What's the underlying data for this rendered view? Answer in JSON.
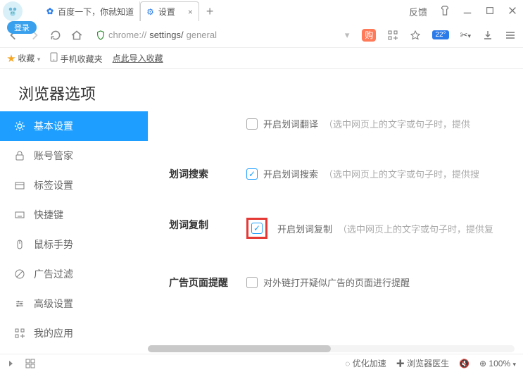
{
  "titlebar": {
    "login_label": "登录",
    "feedback": "反馈",
    "tabs": [
      {
        "title": "百度一下，你就知道",
        "icon": "paw"
      },
      {
        "title": "设置",
        "icon": "gear",
        "active": true
      }
    ]
  },
  "address": {
    "scheme": "chrome://",
    "path": "settings/",
    "page": "general",
    "temp": "22°"
  },
  "bookmarks": {
    "fav_label": "收藏",
    "mobile_fav": "手机收藏夹",
    "import_hint": "点此导入收藏"
  },
  "page": {
    "title": "浏览器选项"
  },
  "sidebar": {
    "items": [
      {
        "label": "基本设置",
        "active": true
      },
      {
        "label": "账号管家"
      },
      {
        "label": "标签设置"
      },
      {
        "label": "快捷键"
      },
      {
        "label": "鼠标手势"
      },
      {
        "label": "广告过滤"
      },
      {
        "label": "高级设置"
      },
      {
        "label": "我的应用"
      }
    ]
  },
  "settings": {
    "translate": {
      "opt_label": "开启划词翻译",
      "hint": "（选中网页上的文字或句子时，提供",
      "checked": false
    },
    "search": {
      "section": "划词搜索",
      "opt_label": "开启划词搜索",
      "hint": "（选中网页上的文字或句子时，提供搜",
      "checked": true
    },
    "copy": {
      "section": "划词复制",
      "opt_label": "开启划词复制",
      "hint": "（选中网页上的文字或句子时，提供复",
      "checked": true,
      "highlighted": true
    },
    "ad": {
      "section": "广告页面提醒",
      "opt_label": "对外链打开疑似广告的页面进行提醒",
      "checked": false
    }
  },
  "status": {
    "accel": "优化加速",
    "doctor": "浏览器医生",
    "zoom": "100%"
  }
}
